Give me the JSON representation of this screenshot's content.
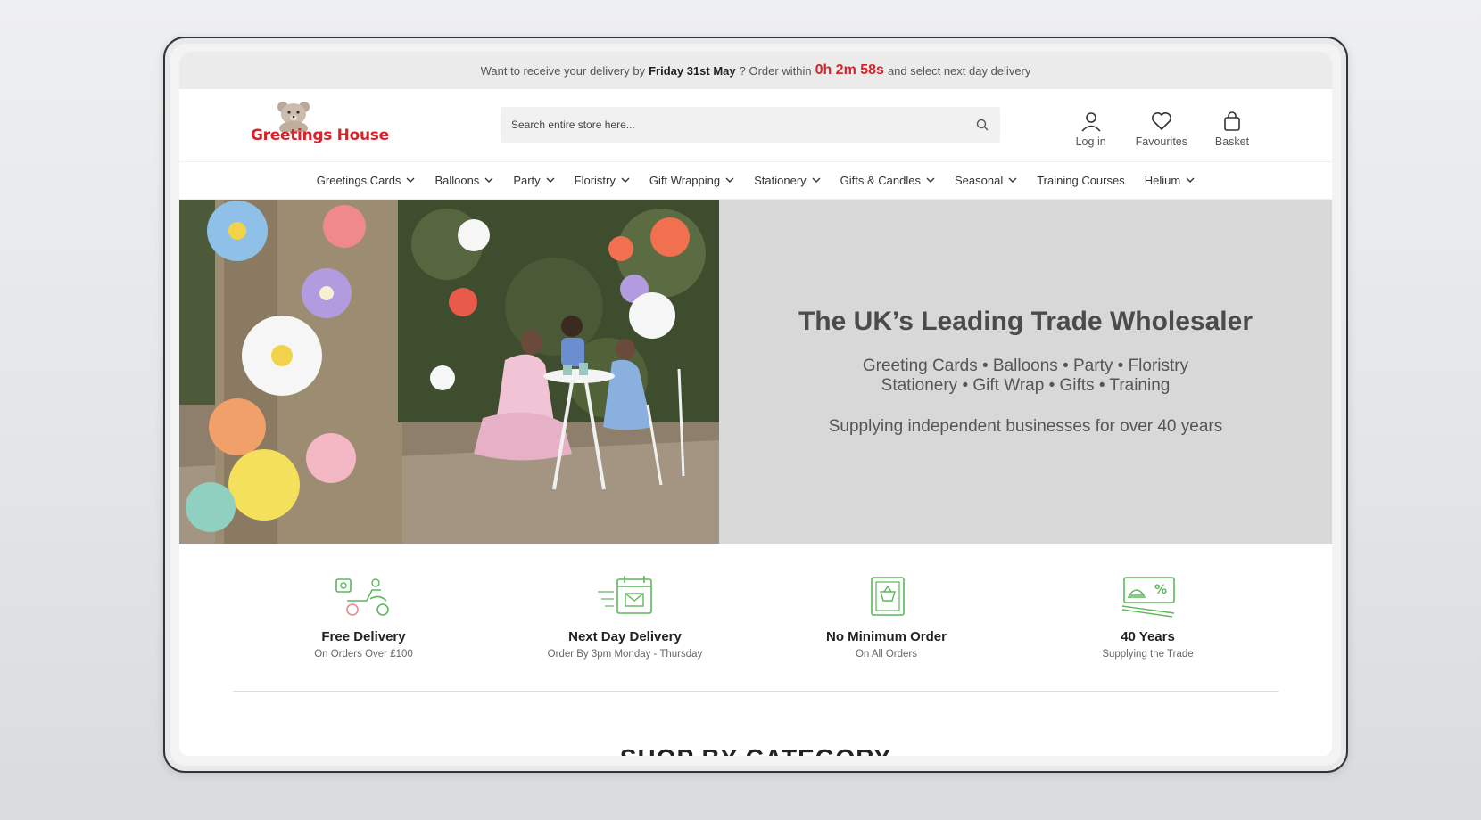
{
  "promo": {
    "prefix": "Want to receive your delivery by",
    "date": "Friday 31st May",
    "middle": "? Order within",
    "timer": "0h 2m 58s",
    "suffix": "and select next day delivery"
  },
  "logo": {
    "text": "Greetings House"
  },
  "search": {
    "placeholder": "Search entire store here..."
  },
  "actions": {
    "login": "Log in",
    "favourites": "Favourites",
    "basket": "Basket"
  },
  "nav": [
    "Greetings Cards",
    "Balloons",
    "Party",
    "Floristry",
    "Gift Wrapping",
    "Stationery",
    "Gifts & Candles",
    "Seasonal",
    "Training Courses",
    "Helium"
  ],
  "hero": {
    "title": "The UK’s Leading Trade Wholesaler",
    "line1": "Greeting Cards • Balloons • Party • Floristry",
    "line2": "Stationery • Gift Wrap • Gifts • Training",
    "tagline": "Supplying independent businesses for over 40 years"
  },
  "features": [
    {
      "title": "Free Delivery",
      "sub": "On Orders Over £100"
    },
    {
      "title": "Next Day Delivery",
      "sub": "Order By 3pm Monday - Thursday"
    },
    {
      "title": "No Minimum Order",
      "sub": "On All Orders"
    },
    {
      "title": "40 Years",
      "sub": "Supplying the Trade"
    }
  ],
  "shop": {
    "title": "SHOP BY CATEGORY"
  },
  "colors": {
    "brand_red": "#d8232a",
    "icon_green": "#5cb85c",
    "hero_bg": "#d8d8d8"
  }
}
